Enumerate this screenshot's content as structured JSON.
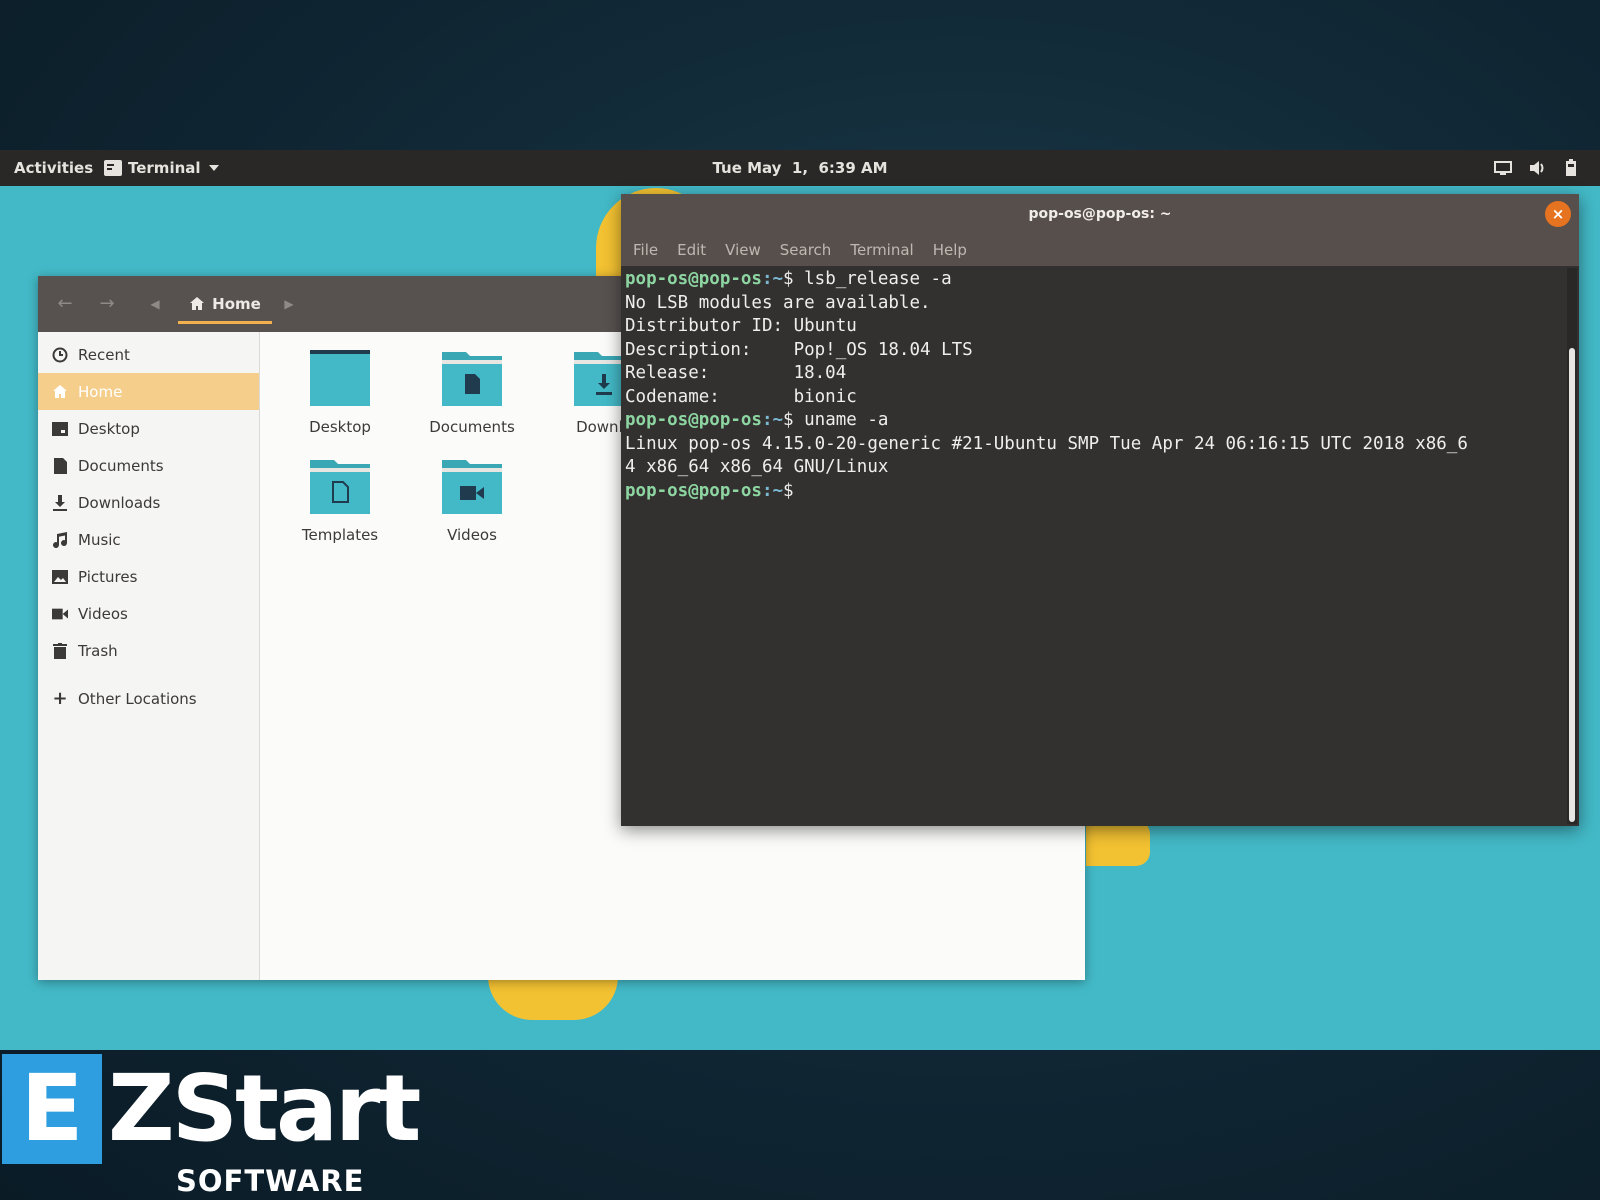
{
  "topbar": {
    "activities": "Activities",
    "app_menu": "Terminal",
    "clock": "Tue May  1,  6:39 AM"
  },
  "files": {
    "path": "Home",
    "sidebar": [
      {
        "label": "Recent",
        "icon": "clock-icon"
      },
      {
        "label": "Home",
        "icon": "home-icon",
        "active": true
      },
      {
        "label": "Desktop",
        "icon": "desktop-icon"
      },
      {
        "label": "Documents",
        "icon": "document-icon"
      },
      {
        "label": "Downloads",
        "icon": "download-icon"
      },
      {
        "label": "Music",
        "icon": "music-icon"
      },
      {
        "label": "Pictures",
        "icon": "picture-icon"
      },
      {
        "label": "Videos",
        "icon": "video-icon"
      },
      {
        "label": "Trash",
        "icon": "trash-icon"
      },
      {
        "label": "Other Locations",
        "icon": "plus-icon"
      }
    ],
    "folders": [
      {
        "label": "Desktop",
        "icon": "folder-desktop-icon"
      },
      {
        "label": "Documents",
        "icon": "folder-documents-icon"
      },
      {
        "label": "Downlo",
        "icon": "folder-downloads-icon"
      },
      {
        "label": "Templates",
        "icon": "folder-templates-icon"
      },
      {
        "label": "Videos",
        "icon": "folder-videos-icon"
      }
    ]
  },
  "terminal": {
    "title": "pop-os@pop-os: ~",
    "close": "×",
    "menu": [
      "File",
      "Edit",
      "View",
      "Search",
      "Terminal",
      "Help"
    ],
    "prompt_user": "pop-os@pop-os",
    "prompt_path": ":~",
    "prompt_symbol": "$",
    "lines": [
      {
        "type": "cmd",
        "text": " lsb_release -a"
      },
      {
        "type": "out",
        "text": "No LSB modules are available."
      },
      {
        "type": "out",
        "text": "Distributor ID:\tUbuntu"
      },
      {
        "type": "out",
        "text": "Description:\tPop!_OS 18.04 LTS"
      },
      {
        "type": "out",
        "text": "Release:\t18.04"
      },
      {
        "type": "out",
        "text": "Codename:\tbionic"
      },
      {
        "type": "cmd",
        "text": " uname -a"
      },
      {
        "type": "out",
        "text": "Linux pop-os 4.15.0-20-generic #21-Ubuntu SMP Tue Apr 24 06:16:15 UTC 2018 x86_6"
      },
      {
        "type": "out",
        "text": "4 x86_64 x86_64 GNU/Linux"
      },
      {
        "type": "cmd",
        "text": ""
      }
    ]
  },
  "logo": {
    "letter": "E",
    "word": "ZStart",
    "sub": "SOFTWARE"
  },
  "colors": {
    "wallpaper": "#43b9c7",
    "accent_orange": "#e6731f",
    "sidebar_active": "#f5ce8c",
    "prompt_green": "#8dd6a2",
    "logo_blue": "#2f9ee0"
  }
}
